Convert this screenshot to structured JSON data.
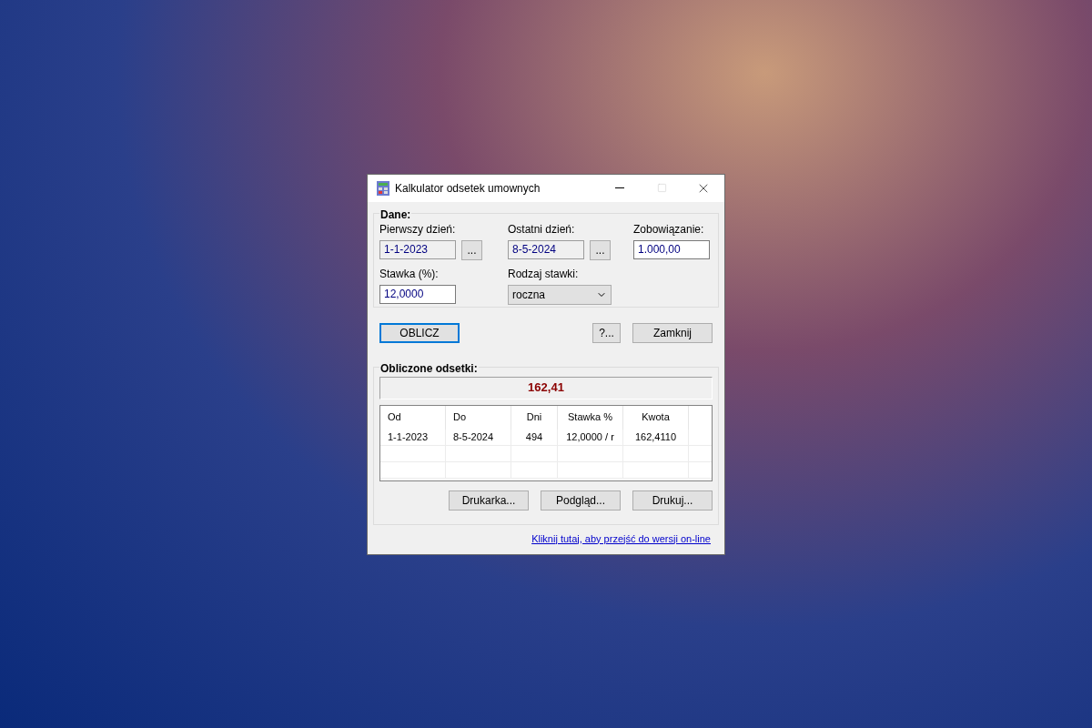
{
  "window": {
    "title": "Kalkulator odsetek umownych"
  },
  "dane": {
    "title": "Dane:",
    "first_day": {
      "label": "Pierwszy dzień:",
      "value": "1-1-2023",
      "readonly": true,
      "button": "..."
    },
    "last_day": {
      "label": "Ostatni dzień:",
      "value": "8-5-2024",
      "readonly": true,
      "button": "..."
    },
    "amount": {
      "label": "Zobowiązanie:",
      "value": "1.000,00",
      "readonly": false
    },
    "rate": {
      "label": "Stawka (%):",
      "value": "12,0000",
      "readonly": false
    },
    "rate_type": {
      "label": "Rodzaj stawki:",
      "value": "roczna"
    }
  },
  "buttons": [
    {
      "label": "OBLICZ",
      "focused": true
    },
    {
      "label": "?...",
      "focused": false
    },
    {
      "label": "Zamknij",
      "focused": false
    }
  ],
  "result": {
    "title": "Obliczone odsetki:",
    "total": "162,41",
    "table": {
      "columns": [
        "Od",
        "Do",
        "Dni",
        "Stawka %",
        "Kwota"
      ],
      "rows": [
        [
          "1-1-2023",
          "8-5-2024",
          "494",
          "12,0000 / r",
          "162,4110"
        ]
      ]
    },
    "buttons": [
      "Drukarka...",
      "Podgląd...",
      "Drukuj..."
    ]
  },
  "link": "Kliknij tutaj, aby przejść do wersji on-line"
}
